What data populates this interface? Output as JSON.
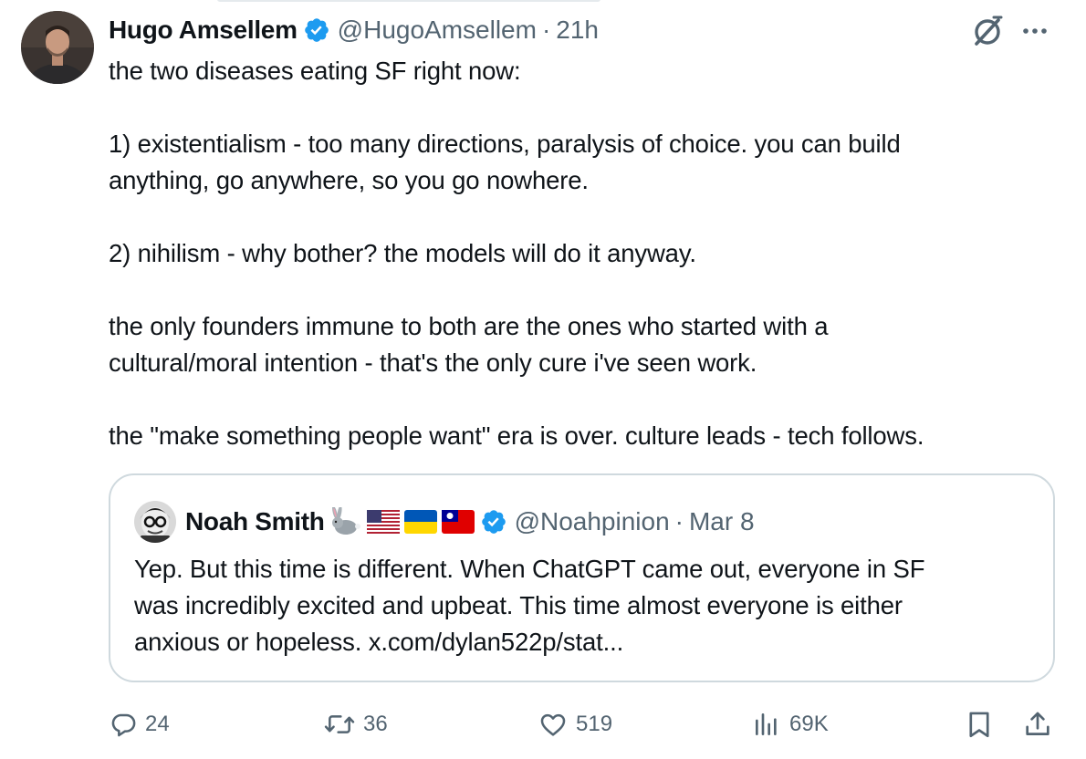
{
  "tweet": {
    "author_name": "Hugo Amsellem",
    "handle": "@HugoAmsellem",
    "separator": "·",
    "time": "21h",
    "text_lines": {
      "l1": "the two diseases eating SF right now:",
      "l2": "1) existentialism - too many directions, paralysis of choice. you can build",
      "l3": "anything, go anywhere, so you go nowhere.",
      "l4": "2) nihilism - why bother? the models will do it anyway.",
      "l5": "the only founders immune to both are the ones who started with a",
      "l6": "cultural/moral intention - that's the only cure i've seen work.",
      "l7": "the \"make something people want\" era is over. culture leads - tech follows."
    }
  },
  "quote": {
    "author_name": "Noah Smith",
    "name_emojis": [
      "rabbit-emoji",
      "us-flag-emoji",
      "ukraine-flag-emoji",
      "taiwan-flag-emoji"
    ],
    "handle": "@Noahpinion",
    "separator": "·",
    "date": "Mar 8",
    "text_lines": {
      "l1": "Yep. But this time is different. When ChatGPT came out, everyone in SF",
      "l2": "was incredibly excited and upbeat. This time almost everyone is either",
      "l3": "anxious or hopeless. x.com/dylan522p/stat..."
    }
  },
  "actions": {
    "replies": "24",
    "reposts": "36",
    "likes": "519",
    "views": "69K"
  },
  "icons": {
    "verified": "verified-badge-icon",
    "grok": "grok-icon",
    "more": "more-icon",
    "reply": "reply-icon",
    "repost": "repost-icon",
    "like": "heart-icon",
    "views": "views-chart-icon",
    "bookmark": "bookmark-icon",
    "share": "share-icon"
  },
  "colors": {
    "verified_blue": "#1d9bf0",
    "text": "#0f1419",
    "secondary": "#536471",
    "border": "#cfd9de"
  }
}
